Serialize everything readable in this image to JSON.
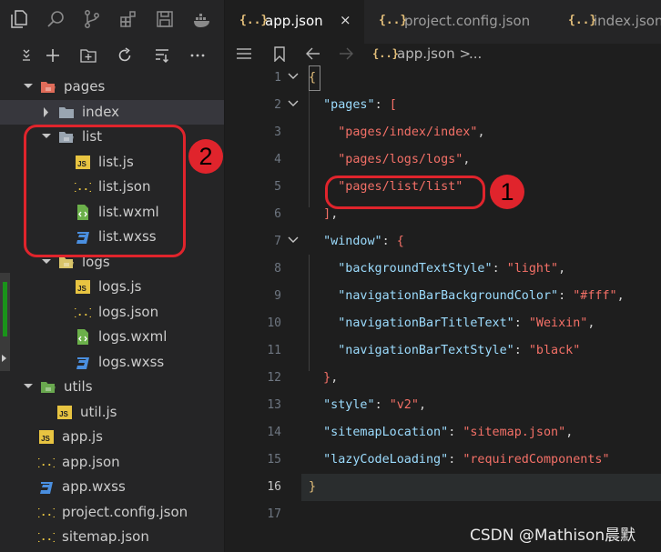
{
  "activity_bar": [
    "files-icon",
    "search-icon",
    "source-control-icon",
    "extensions-icon",
    "debug-icon",
    "docker-icon"
  ],
  "toolbar": [
    "collapse-icon",
    "new-file-icon",
    "new-folder-icon",
    "refresh-icon",
    "sort-icon",
    "more-icon"
  ],
  "tree": [
    {
      "label": "pages",
      "level": 0,
      "type": "folder-open",
      "color": "#e06c5a"
    },
    {
      "label": "index",
      "level": 1,
      "type": "folder-closed",
      "color": "#9aa5b1",
      "selected": true
    },
    {
      "label": "list",
      "level": 1,
      "type": "folder-open",
      "color": "#9aa5b1"
    },
    {
      "label": "list.js",
      "level": 2,
      "type": "js"
    },
    {
      "label": "list.json",
      "level": 2,
      "type": "json"
    },
    {
      "label": "list.wxml",
      "level": 2,
      "type": "wxml"
    },
    {
      "label": "list.wxss",
      "level": 2,
      "type": "wxss"
    },
    {
      "label": "logs",
      "level": 1,
      "type": "folder-open",
      "color": "#d8c46a"
    },
    {
      "label": "logs.js",
      "level": 2,
      "type": "js"
    },
    {
      "label": "logs.json",
      "level": 2,
      "type": "json"
    },
    {
      "label": "logs.wxml",
      "level": 2,
      "type": "wxml"
    },
    {
      "label": "logs.wxss",
      "level": 2,
      "type": "wxss"
    },
    {
      "label": "utils",
      "level": 0,
      "type": "folder-open",
      "color": "#6aa84f"
    },
    {
      "label": "util.js",
      "level": 1,
      "type": "js"
    },
    {
      "label": "app.js",
      "level": 0,
      "type": "js"
    },
    {
      "label": "app.json",
      "level": 0,
      "type": "json"
    },
    {
      "label": "app.wxss",
      "level": 0,
      "type": "wxss"
    },
    {
      "label": "project.config.json",
      "level": 0,
      "type": "json"
    },
    {
      "label": "sitemap.json",
      "level": 0,
      "type": "json"
    }
  ],
  "tabs": [
    {
      "icon": "{..}",
      "label": "app.json",
      "close": "×",
      "active": true
    },
    {
      "icon": "{..}",
      "label": "project.config.json",
      "active": false
    },
    {
      "icon": "{..}",
      "label": "index.json",
      "active": false
    }
  ],
  "breadcrumb": {
    "icon": "{..}",
    "text": "app.json >",
    "more": "..."
  },
  "line_numbers": [
    "1",
    "2",
    "3",
    "4",
    "5",
    "6",
    "7",
    "8",
    "9",
    "10",
    "11",
    "12",
    "13",
    "14",
    "15",
    "16",
    "17"
  ],
  "current_line": "16",
  "code": [
    [
      [
        "br",
        "{"
      ]
    ],
    [
      [
        "p",
        "  "
      ],
      [
        "k",
        "\"pages\""
      ],
      [
        "p",
        ": "
      ],
      [
        "s",
        "["
      ]
    ],
    [
      [
        "p",
        "    "
      ],
      [
        "s",
        "\"pages/index/index\""
      ],
      [
        "p",
        ","
      ]
    ],
    [
      [
        "p",
        "    "
      ],
      [
        "s",
        "\"pages/logs/logs\""
      ],
      [
        "p",
        ","
      ]
    ],
    [
      [
        "p",
        "    "
      ],
      [
        "s",
        "\"pages/list/list\""
      ]
    ],
    [
      [
        "p",
        "  "
      ],
      [
        "s",
        "]"
      ],
      [
        "p",
        ","
      ]
    ],
    [
      [
        "p",
        "  "
      ],
      [
        "k",
        "\"window\""
      ],
      [
        "p",
        ": "
      ],
      [
        "s",
        "{"
      ]
    ],
    [
      [
        "p",
        "    "
      ],
      [
        "k",
        "\"backgroundTextStyle\""
      ],
      [
        "p",
        ": "
      ],
      [
        "s",
        "\"light\""
      ],
      [
        "p",
        ","
      ]
    ],
    [
      [
        "p",
        "    "
      ],
      [
        "k",
        "\"navigationBarBackgroundColor\""
      ],
      [
        "p",
        ": "
      ],
      [
        "s",
        "\"#fff\""
      ],
      [
        "p",
        ","
      ]
    ],
    [
      [
        "p",
        "    "
      ],
      [
        "k",
        "\"navigationBarTitleText\""
      ],
      [
        "p",
        ": "
      ],
      [
        "s",
        "\"Weixin\""
      ],
      [
        "p",
        ","
      ]
    ],
    [
      [
        "p",
        "    "
      ],
      [
        "k",
        "\"navigationBarTextStyle\""
      ],
      [
        "p",
        ": "
      ],
      [
        "s",
        "\"black\""
      ]
    ],
    [
      [
        "p",
        "  "
      ],
      [
        "s",
        "}"
      ],
      [
        "p",
        ","
      ]
    ],
    [
      [
        "p",
        "  "
      ],
      [
        "k",
        "\"style\""
      ],
      [
        "p",
        ": "
      ],
      [
        "s",
        "\"v2\""
      ],
      [
        "p",
        ","
      ]
    ],
    [
      [
        "p",
        "  "
      ],
      [
        "k",
        "\"sitemapLocation\""
      ],
      [
        "p",
        ": "
      ],
      [
        "s",
        "\"sitemap.json\""
      ],
      [
        "p",
        ","
      ]
    ],
    [
      [
        "p",
        "  "
      ],
      [
        "k",
        "\"lazyCodeLoading\""
      ],
      [
        "p",
        ": "
      ],
      [
        "s",
        "\"requiredComponents\""
      ]
    ],
    [
      [
        "br",
        "}"
      ]
    ],
    []
  ],
  "fold_lines": [
    1,
    2,
    7
  ],
  "annotations": [
    {
      "number": "1"
    },
    {
      "number": "2"
    }
  ],
  "watermark": "CSDN @Mathison晨默"
}
